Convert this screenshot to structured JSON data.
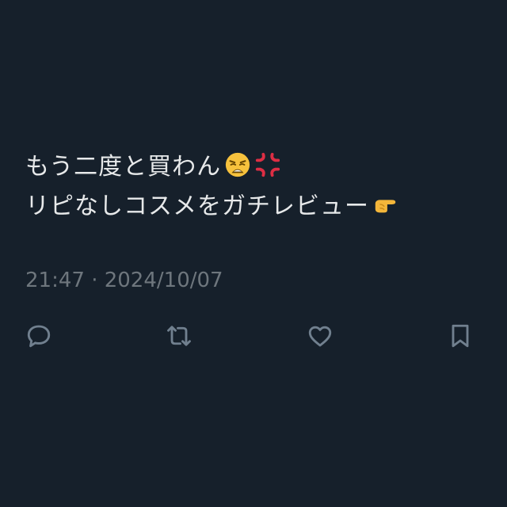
{
  "tweet": {
    "line1_text": "もう二度と買わん",
    "line1_emojis": [
      "weary-face-emoji",
      "anger-symbol-emoji"
    ],
    "line2_text": "リピなしコスメをガチレビュー",
    "line2_emojis": [
      "pointing-right-emoji"
    ],
    "timestamp": "21:47 · 2024/10/07"
  },
  "actions": {
    "icons": [
      "reply-icon",
      "retweet-icon",
      "like-icon",
      "bookmark-icon"
    ]
  },
  "colors": {
    "background": "#16202b",
    "text": "#e7e9ea",
    "secondary_text": "#6e767d",
    "icon": "#71808f"
  }
}
